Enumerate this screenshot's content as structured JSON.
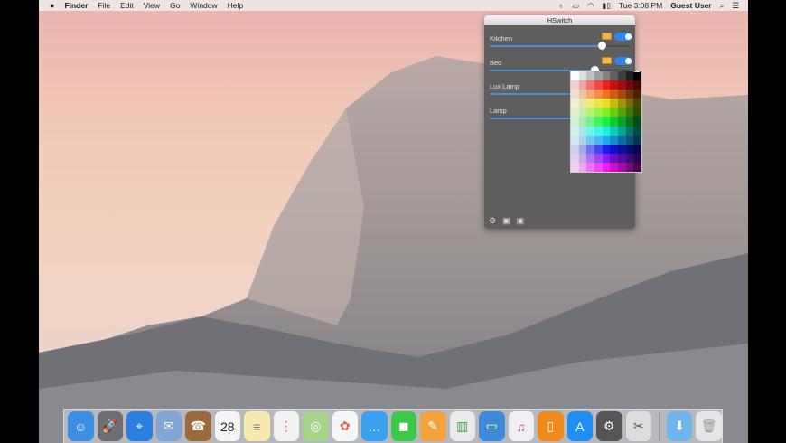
{
  "menubar": {
    "apple": "",
    "app": "Finder",
    "menus": [
      "File",
      "Edit",
      "View",
      "Go",
      "Window",
      "Help"
    ],
    "clock": "Tue 3:08 PM",
    "user": "Guest User",
    "status_icons": [
      "hswitch-bulb-icon",
      "airplay-icon",
      "wifi-icon",
      "battery-icon",
      "spotlight-icon",
      "notification-center-icon"
    ]
  },
  "panel": {
    "title": "HSwitch",
    "devices": [
      {
        "name": "Kitchen",
        "brightness": 0.8,
        "on": true
      },
      {
        "name": "Bed",
        "brightness": 0.75,
        "on": true
      },
      {
        "name": "Lux Lamp",
        "brightness": 0.75
      },
      {
        "name": "Lamp",
        "brightness": 0.75
      }
    ],
    "footer_icons": [
      "gear-icon",
      "device-icon",
      "device-icon-2"
    ]
  },
  "dock": {
    "apps": [
      {
        "name": "Finder",
        "glyph": "☺",
        "color": "#3a8ee6",
        "running": true
      },
      {
        "name": "Launchpad",
        "glyph": "🚀",
        "color": "#6b6e75"
      },
      {
        "name": "Safari",
        "glyph": "⌖",
        "color": "#2a7fe0",
        "running": true
      },
      {
        "name": "Mail",
        "glyph": "✉",
        "color": "#7fa6d4"
      },
      {
        "name": "Contacts",
        "glyph": "☎",
        "color": "#9a6a3a"
      },
      {
        "name": "Calendar",
        "glyph": "28",
        "color": "#f5f5f5",
        "text": "#222"
      },
      {
        "name": "Notes",
        "glyph": "≡",
        "color": "#f6eab0",
        "text": "#777"
      },
      {
        "name": "Reminders",
        "glyph": "⋮",
        "color": "#f2f2f2",
        "text": "#e44"
      },
      {
        "name": "Maps",
        "glyph": "◎",
        "color": "#a7d48b"
      },
      {
        "name": "Photos",
        "glyph": "✿",
        "color": "#f6f6f6",
        "text": "#e5594a"
      },
      {
        "name": "Messages",
        "glyph": "…",
        "color": "#3aa0f0"
      },
      {
        "name": "FaceTime",
        "glyph": "◼",
        "color": "#3cc94a"
      },
      {
        "name": "Pages",
        "glyph": "✎",
        "color": "#f3a33a"
      },
      {
        "name": "Numbers",
        "glyph": "▥",
        "color": "#eaeaea",
        "text": "#3b9d3b"
      },
      {
        "name": "Keynote",
        "glyph": "▭",
        "color": "#3c8ad8"
      },
      {
        "name": "iTunes",
        "glyph": "♫",
        "color": "#f0f0f0",
        "text": "#e24aa0"
      },
      {
        "name": "iBooks",
        "glyph": "▯",
        "color": "#f08a1c"
      },
      {
        "name": "App Store",
        "glyph": "A",
        "color": "#1f8ef0"
      },
      {
        "name": "System Preferences",
        "glyph": "⚙",
        "color": "#555"
      },
      {
        "name": "Preview",
        "glyph": "✂",
        "color": "#ddd",
        "text": "#555",
        "running": true
      }
    ],
    "others": [
      {
        "name": "Downloads",
        "glyph": "⬇",
        "color": "#6eb6ea"
      },
      {
        "name": "Trash",
        "glyph": "🗑",
        "color": "#e6e6e6",
        "text": "#999"
      }
    ]
  }
}
